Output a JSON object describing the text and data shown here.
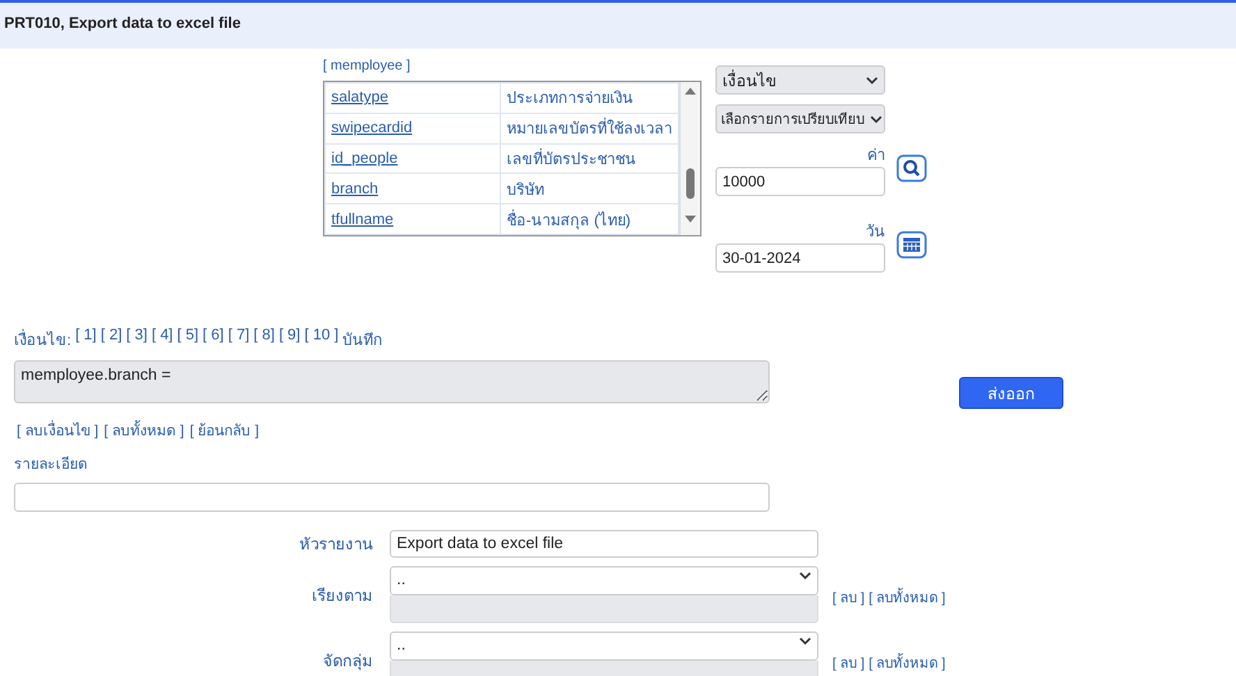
{
  "header": {
    "title": "PRT010, Export data to excel file"
  },
  "field_list": {
    "table": "[ memployee ]",
    "rows": [
      {
        "field": "salatype",
        "label": "ประเภทการจ่ายเงิน"
      },
      {
        "field": "swipecardid",
        "label": "หมายเลขบัตรที่ใช้ลงเวลา"
      },
      {
        "field": "id_people",
        "label": "เลขที่บัตรประชาชน"
      },
      {
        "field": "branch",
        "label": "บริษัท"
      },
      {
        "field": "tfullname",
        "label": "ชื่อ-นามสกุล (ไทย)"
      }
    ]
  },
  "condition": {
    "select": "เงื่อนไข",
    "compare": "เลือกรายการเปรียบเทียบ",
    "value_label": "ค่า",
    "value": "10000",
    "date_label": "วัน",
    "date": "30-01-2024"
  },
  "conditions": {
    "label": "เงื่อนไข:",
    "links": [
      "[ 1]",
      "[ 2]",
      "[ 3]",
      "[ 4]",
      "[ 5]",
      "[ 6]",
      "[ 7]",
      "[ 8]",
      "[ 9]",
      "[ 10 ]"
    ],
    "save": "บันทึก"
  },
  "expression": "memployee.branch =",
  "actions": [
    "[ ลบเงื่อนไข ]",
    "[ ลบทั้งหมด ]",
    "[ ย้อนกลับ ]"
  ],
  "detail": {
    "label": "รายละเอียด"
  },
  "export_button": "ส่งออก",
  "report": {
    "title_label": "หัวรายงาน",
    "title": "Export data to excel file",
    "selects": [
      {
        "label": "เรียงตาม",
        "value": "..",
        "links": [
          "[ ลบ ]",
          "[ ลบทั้งหมด ]"
        ]
      },
      {
        "label": "จัดกลุ่ม",
        "value": "..",
        "links": [
          "[ ลบ ]",
          "[ ลบทั้งหมด ]"
        ]
      }
    ]
  }
}
